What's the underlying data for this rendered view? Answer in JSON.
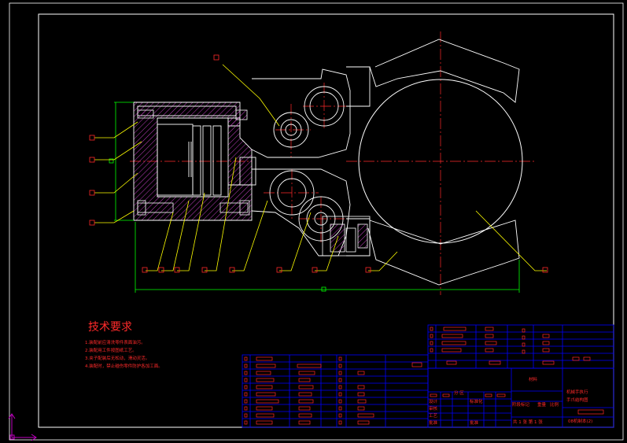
{
  "drawing": {
    "colors": {
      "background": "#000000",
      "frame": "#ffffff",
      "outline": "#ffffff",
      "center_line": "#ff2a2a",
      "leader": "#ffff00",
      "hatch": "#c040c0",
      "dimension": "#00ff00",
      "table_line": "#0000ff",
      "text": "#ff2a2a"
    },
    "balloon_marker": "□",
    "tech_requirements": {
      "title": "技术要求",
      "lines": [
        "1.装配前应清洗零件表面油污。",
        "2.装配用工件按图纸工艺。",
        "3.夹子配装后无松动，滑动灵活。",
        "4.装配时，禁止碰伤零件防护各加工面。"
      ]
    },
    "title_block": {
      "drawing_name_line1": "机械手执行",
      "drawing_name_line2": "手爪结构图",
      "drawing_number": "08机制本(2)",
      "label_sign": "设计",
      "label_check": "审核",
      "label_process": "工艺",
      "label_standard": "标准化",
      "label_approve": "批准",
      "label_stage": "阶段标记",
      "label_weight": "重量",
      "label_scale": "比例",
      "label_sheets": "共 1 张  第 1 张",
      "material": "材料",
      "divider_cells": "分  区"
    }
  }
}
